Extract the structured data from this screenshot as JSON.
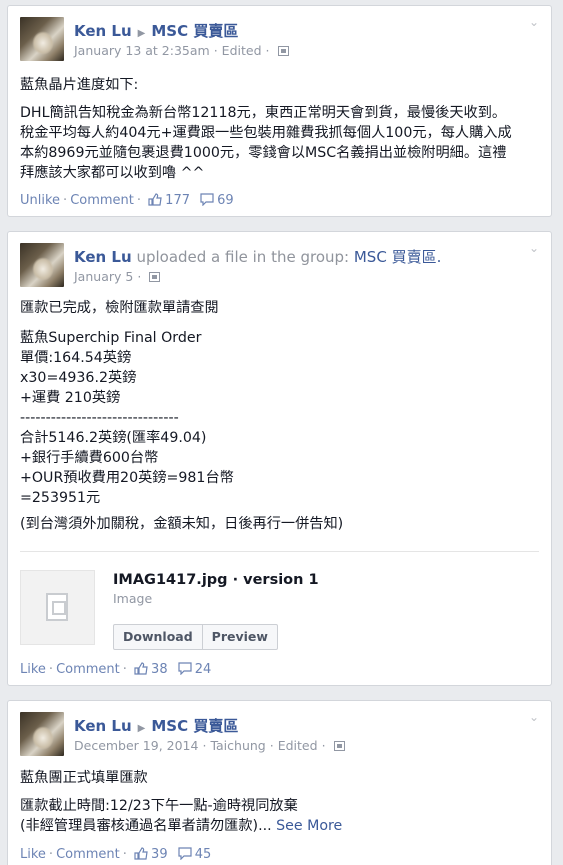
{
  "posts": [
    {
      "author": "Ken Lu",
      "group": "MSC 買賣區",
      "date": "January 13 at 2:35am",
      "edited": "Edited",
      "lines": [
        "藍魚晶片進度如下:",
        "",
        "DHL簡訊告知稅金為新台幣12118元，東西正常明天會到貨，最慢後天收到。",
        "稅金平均每人約404元+運費跟一些包裝用雜費我抓每個人100元，每人購入成",
        "本約8969元並隨包裹退費1000元，零錢會以MSC名義捐出並檢附明細。這禮",
        "拜應該大家都可以收到嚕 ^^"
      ],
      "actions": {
        "unlike": "Unlike",
        "comment": "Comment",
        "likes": "177",
        "comments": "69"
      }
    },
    {
      "author": "Ken Lu",
      "uploaded_text": "uploaded a file in the group:",
      "group": "MSC 買賣區.",
      "date": "January 5",
      "lines": [
        "匯款已完成，檢附匯款單請查閱",
        "",
        "藍魚Superchip Final Order",
        "單價:164.54英鎊",
        "x30=4936.2英鎊",
        "+運費 210英鎊",
        "-------------------------------",
        "合計5146.2英鎊(匯率49.04)",
        "+銀行手續費600台幣",
        "+OUR預收費用20英鎊=981台幣",
        "=253951元",
        "",
        "(到台灣須外加關稅，金額未知，日後再行一併告知)"
      ],
      "file": {
        "title": "IMAG1417.jpg · version 1",
        "type": "Image",
        "download": "Download",
        "preview": "Preview"
      },
      "actions": {
        "like": "Like",
        "comment": "Comment",
        "likes": "38",
        "comments": "24"
      }
    },
    {
      "author": "Ken Lu",
      "group": "MSC 買賣區",
      "date": "December 19, 2014",
      "location": "Taichung",
      "edited": "Edited",
      "lines": [
        "藍魚團正式填單匯款",
        "",
        "匯款截止時間:12/23下午一點-逾時視同放棄",
        "(非經管理員審核通過名單者請勿匯款)..."
      ],
      "see_more": "See More",
      "actions": {
        "like": "Like",
        "comment": "Comment",
        "likes": "39",
        "comments": "45"
      }
    }
  ]
}
